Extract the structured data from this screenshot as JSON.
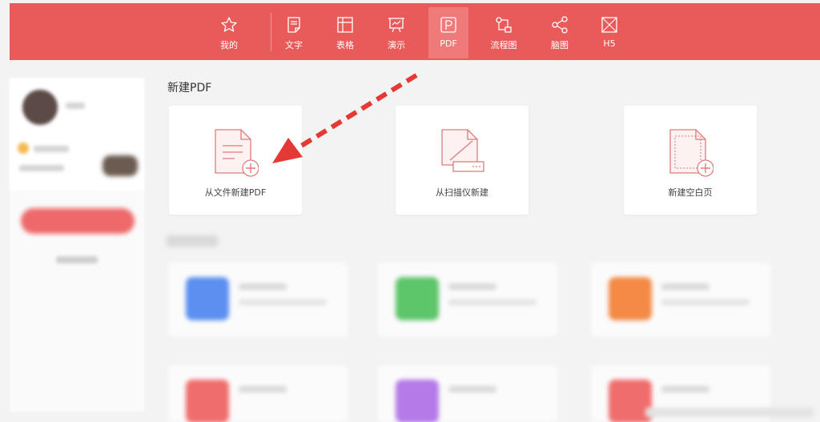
{
  "toolbar": {
    "items": [
      {
        "id": "mine",
        "label": "我的",
        "icon": "star-icon"
      },
      {
        "id": "text",
        "label": "文字",
        "icon": "document-icon"
      },
      {
        "id": "table",
        "label": "表格",
        "icon": "table-icon"
      },
      {
        "id": "present",
        "label": "演示",
        "icon": "presentation-icon"
      },
      {
        "id": "pdf",
        "label": "PDF",
        "icon": "pdf-icon"
      },
      {
        "id": "flow",
        "label": "流程图",
        "icon": "flowchart-icon"
      },
      {
        "id": "mind",
        "label": "脑图",
        "icon": "mindmap-icon"
      },
      {
        "id": "h5",
        "label": "H5",
        "icon": "h5-icon"
      }
    ],
    "active": "PDF"
  },
  "main": {
    "section_title": "新建PDF",
    "cards": [
      {
        "label": "从文件新建PDF",
        "icon": "file-add-icon"
      },
      {
        "label": "从扫描仪新建",
        "icon": "scanner-icon"
      },
      {
        "label": "新建空白页",
        "icon": "blank-page-icon"
      }
    ]
  },
  "colors": {
    "toolbar_bg": "#e95b5b",
    "active_tab": "#f07a7a",
    "icon_stroke": "#e07b7b",
    "arrow": "#e53935"
  },
  "templates": {
    "colors": [
      "#5c8ff0",
      "#5dc56a",
      "#f38a45",
      "#f06d6d",
      "#b579e8",
      "#f06d6d"
    ]
  }
}
